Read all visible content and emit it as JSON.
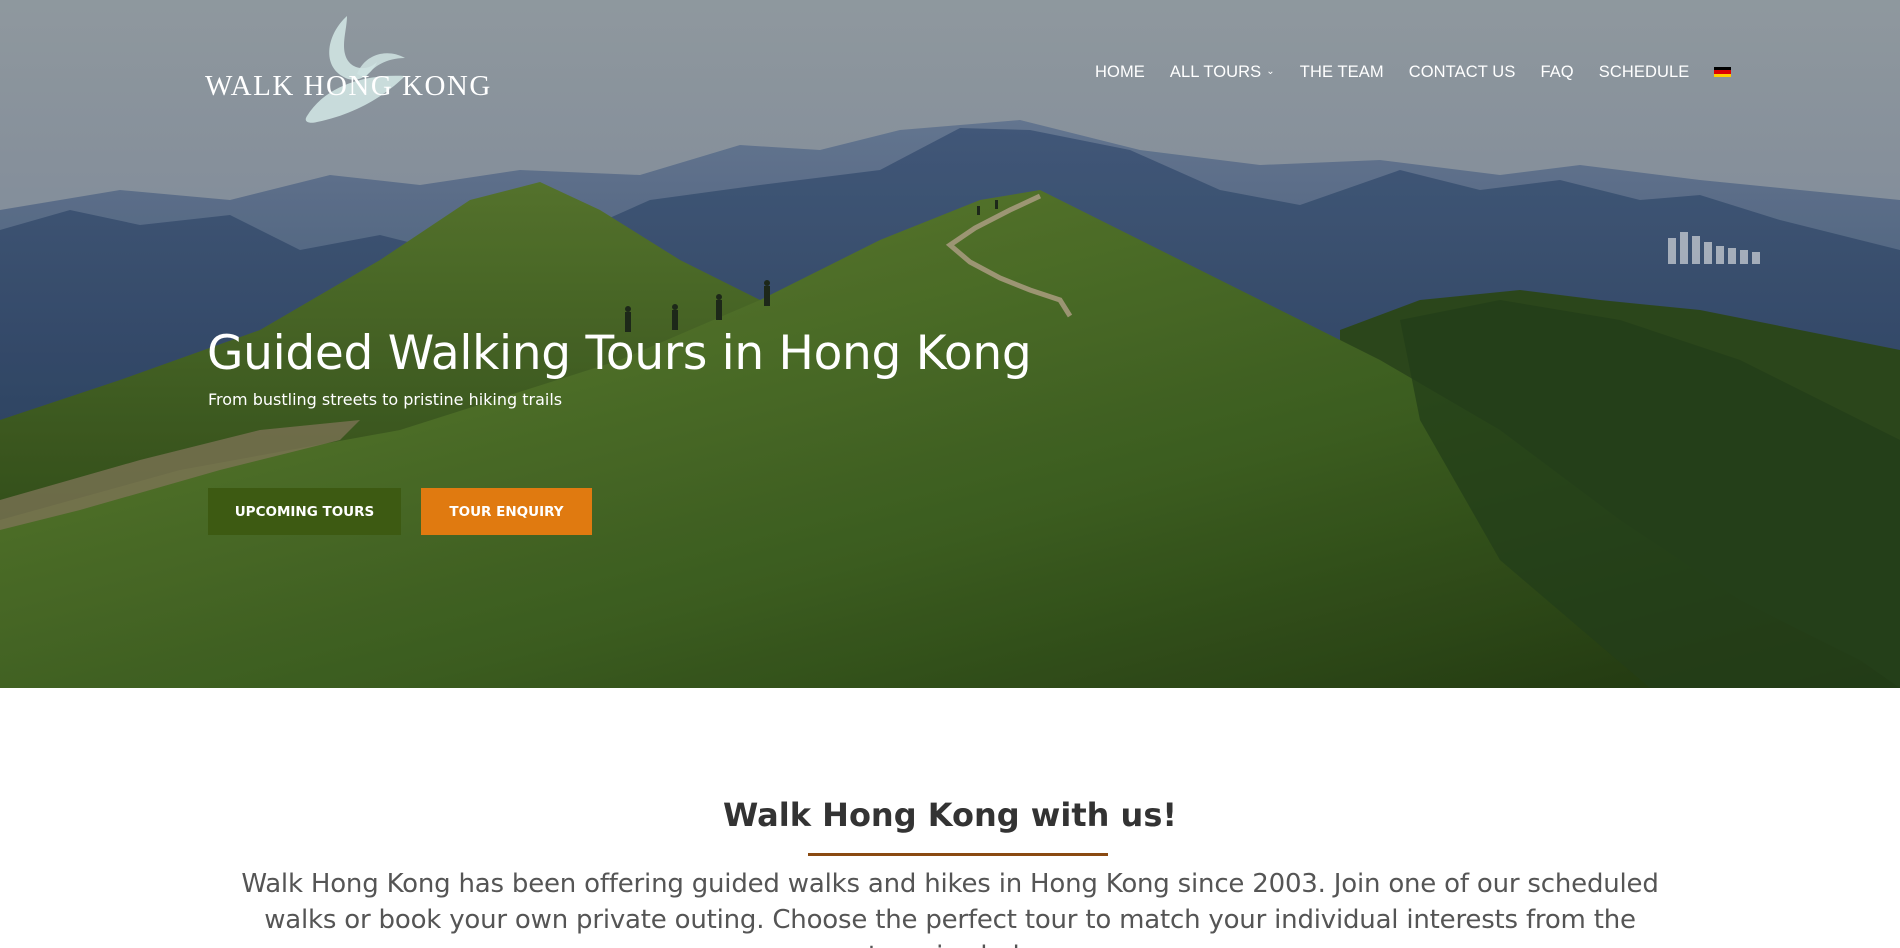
{
  "brand": {
    "logo_text": "WALK HONG KONG",
    "mark_color": "#cfe3e2"
  },
  "nav": {
    "items": [
      {
        "label": "HOME"
      },
      {
        "label": "ALL TOURS",
        "has_dropdown": true
      },
      {
        "label": "THE TEAM"
      },
      {
        "label": "CONTACT US"
      },
      {
        "label": "FAQ"
      },
      {
        "label": "SCHEDULE"
      }
    ],
    "language_flag": "german-flag-icon"
  },
  "hero": {
    "title": "Guided Walking Tours in Hong Kong",
    "subtitle": "From bustling streets to pristine hiking trails",
    "image": "mountain-ridge-hikers-photo"
  },
  "buttons": {
    "upcoming": "UPCOMING TOURS",
    "enquiry": "TOUR ENQUIRY"
  },
  "intro": {
    "title": "Walk Hong Kong with us!",
    "text": "Walk Hong Kong has been offering guided walks and hikes in Hong Kong since 2003. Join one of our scheduled walks or book your own private outing. Choose the perfect tour to match your individual interests from the categories below."
  },
  "colors": {
    "primary_green": "#3d5a12",
    "accent_orange": "#e07a10",
    "divider_brown": "#8a4a12"
  }
}
